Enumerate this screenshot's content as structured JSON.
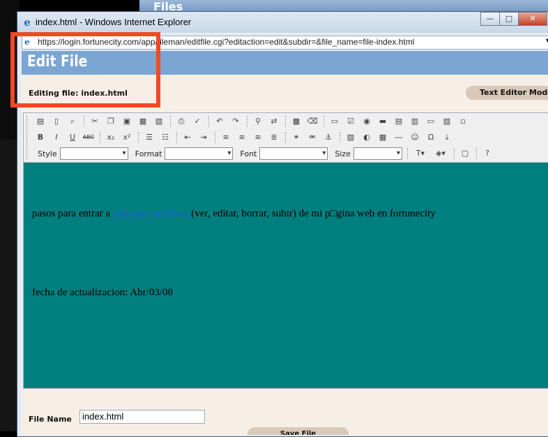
{
  "background_tab": {
    "label": "Files"
  },
  "window": {
    "title": "index.html - Windows Internet Explorer",
    "minimize": "—",
    "maximize": "□",
    "close": "✕"
  },
  "address": {
    "url": "https://login.fortunecity.com/app/fileman/editfile.cgi?editaction=edit&subdir=&file_name=file-index.html"
  },
  "page": {
    "heading": "Edit File",
    "editing_label": "Editing file: index.html",
    "mode_button": "Text Editor Mode"
  },
  "toolbar": {
    "style_label": "Style",
    "format_label": "Format",
    "font_label": "Font",
    "size_label": "Size"
  },
  "editor": {
    "line1_before": "pasos para entrar a ",
    "line1_link": "editamos archivos",
    "line1_after": " (ver, editar, borrar, subir) de mi p□gina web en fortunecity",
    "line2": "fecha de actualizacion: Abr/03/08"
  },
  "form": {
    "file_name_label": "File Name",
    "file_name_value": "index.html",
    "save_button": "Save File"
  },
  "colors": {
    "accent": "#7ba5d2",
    "editor_bg": "#007f7f",
    "highlight": "#f04a24"
  }
}
